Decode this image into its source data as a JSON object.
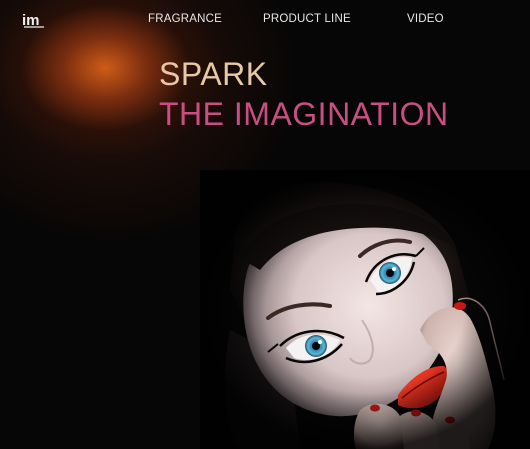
{
  "header": {
    "logo_text": "im"
  },
  "nav": {
    "items": [
      {
        "label": "FRAGRANCE"
      },
      {
        "label": "PRODUCT LINE"
      },
      {
        "label": "VIDEO"
      }
    ]
  },
  "hero": {
    "headline_line1": "SPARK",
    "headline_line2": "THE IMAGINATION"
  },
  "colors": {
    "background": "#060606",
    "glow": "#d66018",
    "headline_primary": "#e8c9a6",
    "headline_accent": "#c94f83",
    "nav_text": "#e9e6e6"
  }
}
